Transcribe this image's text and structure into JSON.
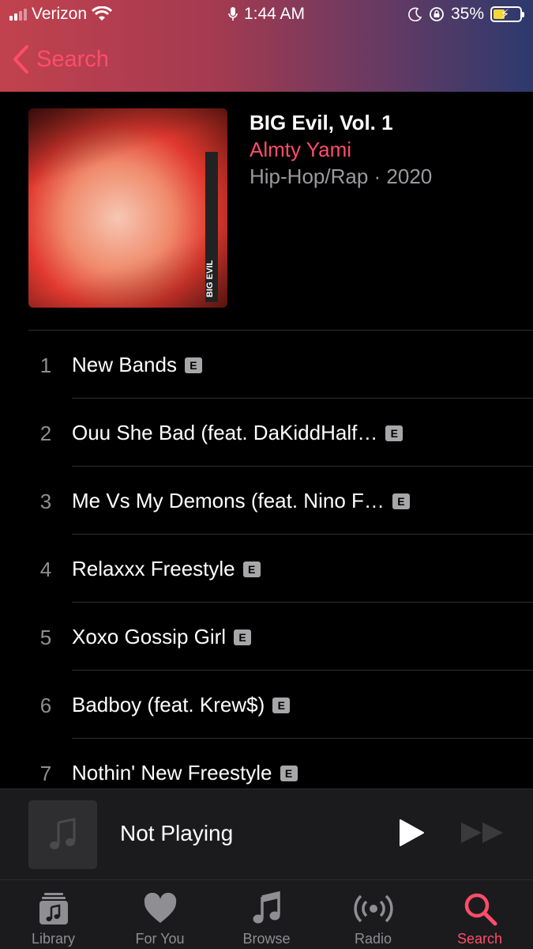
{
  "status_bar": {
    "carrier": "Verizon",
    "time": "1:44 AM",
    "battery": "35%"
  },
  "nav": {
    "back_label": "Search"
  },
  "album": {
    "title": "BIG Evil, Vol. 1",
    "artist": "Almty Yami",
    "meta": "Hip-Hop/Rap · 2020",
    "art_text": "BIG EVIL"
  },
  "tracks": [
    {
      "num": "1",
      "title": "New Bands",
      "explicit": "E"
    },
    {
      "num": "2",
      "title": "Ouu She Bad (feat. DaKiddHalf…",
      "explicit": "E"
    },
    {
      "num": "3",
      "title": "Me Vs My Demons (feat. Nino F…",
      "explicit": "E"
    },
    {
      "num": "4",
      "title": "Relaxxx Freestyle",
      "explicit": "E"
    },
    {
      "num": "5",
      "title": "Xoxo Gossip Girl",
      "explicit": "E"
    },
    {
      "num": "6",
      "title": "Badboy (feat. Krew$)",
      "explicit": "E"
    },
    {
      "num": "7",
      "title": "Nothin' New Freestyle",
      "explicit": "E"
    }
  ],
  "mini_player": {
    "title": "Not Playing",
    "art_icon": "music-note-icon"
  },
  "tabs": [
    {
      "label": "Library",
      "icon": "library-icon"
    },
    {
      "label": "For You",
      "icon": "heart-icon"
    },
    {
      "label": "Browse",
      "icon": "music-note-icon"
    },
    {
      "label": "Radio",
      "icon": "radio-icon"
    },
    {
      "label": "Search",
      "icon": "search-icon"
    }
  ],
  "colors": {
    "accent": "#ff4d6a",
    "secondary_text": "#9a9a9e",
    "background": "#000000"
  }
}
